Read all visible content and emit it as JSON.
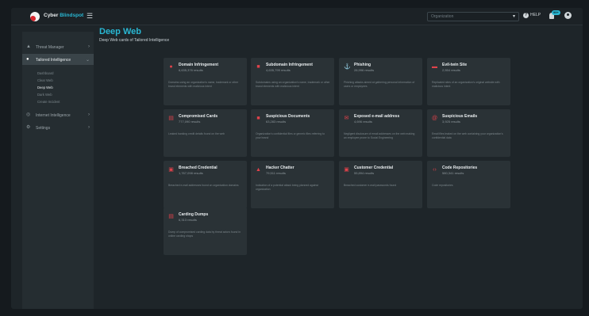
{
  "header": {
    "brand_prefix": "Cyber ",
    "brand_accent": "Blindspot",
    "menu_icon": "hamburger-icon",
    "organization_placeholder": "Organization",
    "help_label": "HELP",
    "notification_badge": "99+",
    "colors": {
      "accent": "#29b7d3",
      "brand_red": "#d7262e"
    }
  },
  "sidebar": {
    "items": [
      {
        "label": "Threat Manager",
        "icon": "warning-icon"
      },
      {
        "label": "Tailored Intelligence",
        "icon": "user-icon"
      },
      {
        "label": "Internet Intelligence",
        "icon": "globe-icon"
      },
      {
        "label": "Settings",
        "icon": "gear-icon"
      }
    ],
    "subitems": [
      "Dashboard",
      "Clear Web",
      "Deep Web",
      "Dark Web",
      "Create Incident"
    ]
  },
  "page": {
    "title": "Deep Web",
    "subtitle": "Deep Web cards of Tailored Intelligence"
  },
  "cards": [
    {
      "title": "Domain Infringement",
      "count": "6,635,376 results",
      "icon": "alert-circle-icon",
      "description": "Domains using an organization's name, trademark or other brand elements with malicious intent"
    },
    {
      "title": "Subdomain Infringement",
      "count": "4,635,799 results",
      "icon": "layers-icon",
      "description": "Subdomains using an organization's name, trademark or other brand elements with malicious intent"
    },
    {
      "title": "Phishing",
      "count": "28,996 results",
      "icon": "hook-icon",
      "description": "Phishing attacks aimed at gathering personal information of users or employees"
    },
    {
      "title": "Evil-twin Site",
      "count": "2,554 results",
      "icon": "twin-icon",
      "description": "Replicated sites of an organization's original website with malicious intent"
    },
    {
      "title": "Compromised Cards",
      "count": "777,090 results",
      "icon": "credit-card-icon",
      "description": "Leaked banking credit details found on the web"
    },
    {
      "title": "Suspicious Documents",
      "count": "63,283 results",
      "icon": "folder-icon",
      "description": "Organization's confidential files or generic files referring to your brand"
    },
    {
      "title": "Exposed e-mail address",
      "count": "4,696 results",
      "icon": "envelope-icon",
      "description": "Negligent disclosure of email addresses on the web making an employee prone to Social Engineering"
    },
    {
      "title": "Suspicious Emails",
      "count": "3,925 results",
      "icon": "at-sign-icon",
      "description": "Email files leaked on the web containing your organization's confidential data"
    },
    {
      "title": "Breached Credential",
      "count": "1,767,098 results",
      "icon": "lock-icon",
      "description": "Breached e-mail addresses found on organization domains"
    },
    {
      "title": "Hacker Chatter",
      "count": "79,511 results",
      "icon": "chat-icon",
      "description": "Indication of a potential attack being planned against organization"
    },
    {
      "title": "Customer Credential",
      "count": "55,894 results",
      "icon": "lock-icon",
      "description": "Breached customer e-mail passwords found"
    },
    {
      "title": "Code Repositories",
      "count": "580,341 results",
      "icon": "code-icon",
      "description": "Code repositories"
    },
    {
      "title": "Carding Dumps",
      "count": "6,313 results",
      "icon": "credit-card-icon",
      "description": "Dump of compromised carding data by threat actors found in online carding shops"
    }
  ]
}
